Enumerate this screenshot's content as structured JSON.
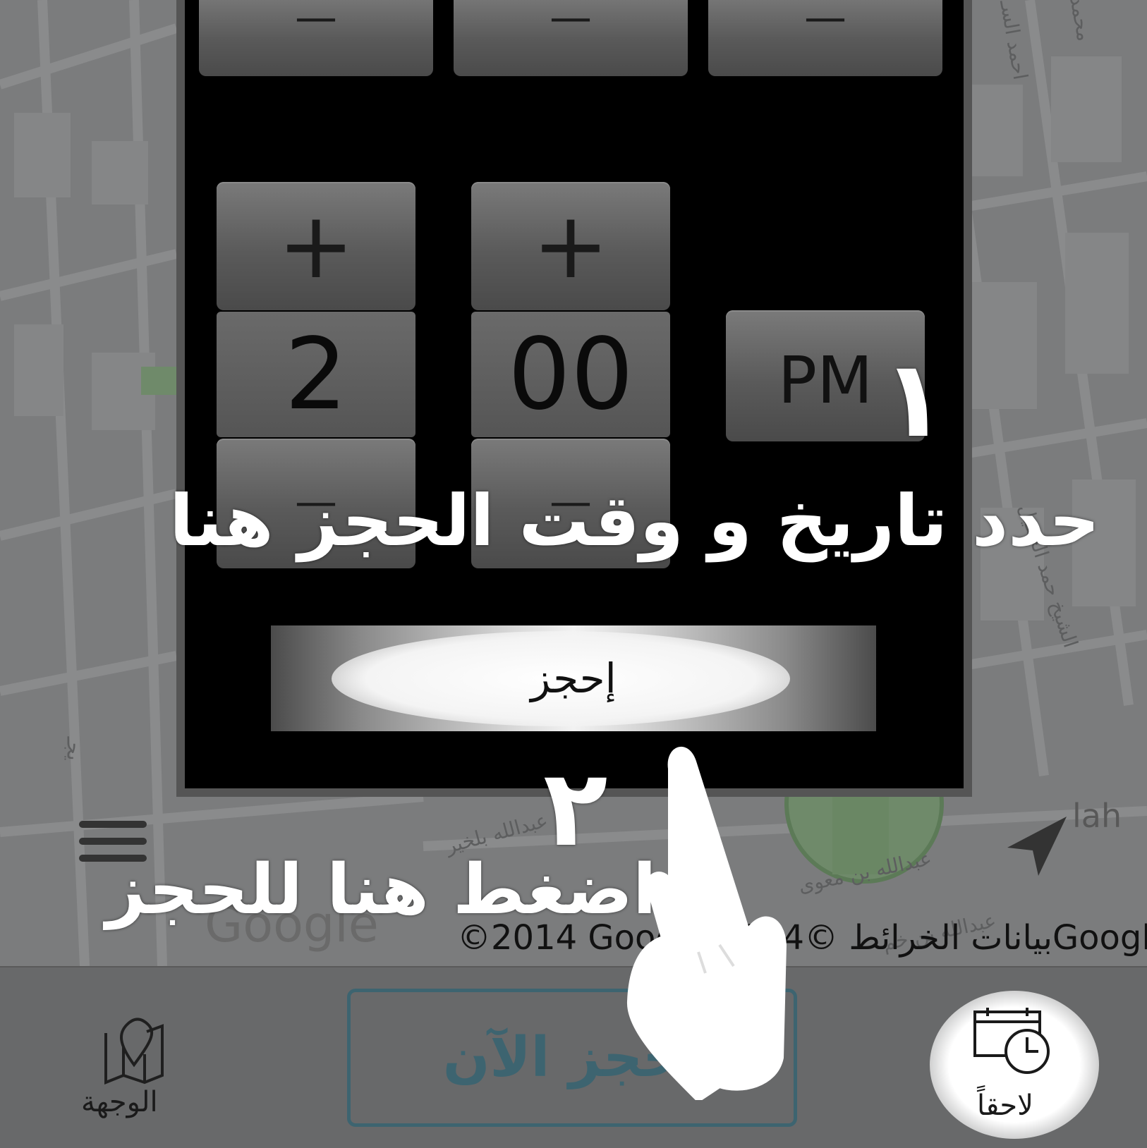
{
  "map": {
    "streets": [
      "احمد السـ",
      "محمد",
      "الشيخ حمد الحقيل",
      "عبدالله بلخير",
      "عبدالله بن معوى",
      "عبدالله بن خم",
      "lah",
      "يجـ"
    ],
    "watermark": "Google"
  },
  "time_picker": {
    "hour": "2",
    "minute": "00",
    "ampm": "PM",
    "increment_symbol": "+",
    "decrement_symbol": "—"
  },
  "book_button_label": "إحجز",
  "overlay": {
    "step1_number": "١",
    "step1_text": "حدد تاريخ و وقت الحجز هنا",
    "step2_number": "٢",
    "step2_text": "اضغط هنا للحجز"
  },
  "copyright": "©2014 Google بيانات الخرائط ©2014Google",
  "bottom_bar": {
    "destination_label": "الوجهة",
    "book_now_label": "إحجز الآن",
    "later_label": "لاحقاً"
  },
  "colors": {
    "panel": "#000000",
    "accent": "#3d6470",
    "overlay_text": "#ffffff"
  },
  "icons": [
    "menu-icon",
    "navigation-arrow-icon",
    "map-location-icon",
    "calendar-clock-icon",
    "pointing-hand-icon"
  ]
}
